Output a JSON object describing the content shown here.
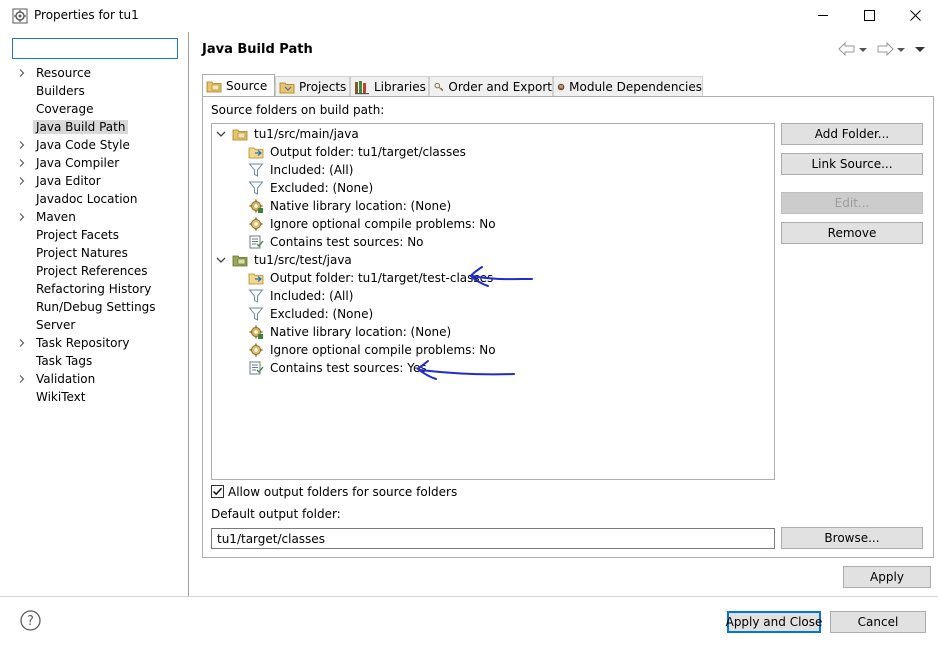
{
  "window": {
    "title": "Properties for tu1",
    "icons": {
      "app": "properties-icon",
      "minimize": "minimize-icon",
      "maximize": "maximize-icon",
      "close": "close-icon"
    }
  },
  "filter": {
    "value": "",
    "placeholder": ""
  },
  "nav": {
    "items": [
      {
        "label": "Resource",
        "expandable": true
      },
      {
        "label": "Builders",
        "expandable": false
      },
      {
        "label": "Coverage",
        "expandable": false
      },
      {
        "label": "Java Build Path",
        "expandable": false,
        "selected": true
      },
      {
        "label": "Java Code Style",
        "expandable": true
      },
      {
        "label": "Java Compiler",
        "expandable": true
      },
      {
        "label": "Java Editor",
        "expandable": true
      },
      {
        "label": "Javadoc Location",
        "expandable": false
      },
      {
        "label": "Maven",
        "expandable": true
      },
      {
        "label": "Project Facets",
        "expandable": false
      },
      {
        "label": "Project Natures",
        "expandable": false
      },
      {
        "label": "Project References",
        "expandable": false
      },
      {
        "label": "Refactoring History",
        "expandable": false
      },
      {
        "label": "Run/Debug Settings",
        "expandable": false
      },
      {
        "label": "Server",
        "expandable": false
      },
      {
        "label": "Task Repository",
        "expandable": true
      },
      {
        "label": "Task Tags",
        "expandable": false
      },
      {
        "label": "Validation",
        "expandable": true
      },
      {
        "label": "WikiText",
        "expandable": false
      }
    ]
  },
  "page": {
    "title": "Java Build Path"
  },
  "tabs": [
    {
      "label": "Source",
      "icon": "source-folder-icon",
      "active": true
    },
    {
      "label": "Projects",
      "icon": "projects-icon",
      "active": false
    },
    {
      "label": "Libraries",
      "icon": "libraries-icon",
      "active": false
    },
    {
      "label": "Order and Export",
      "icon": "order-export-icon",
      "active": false
    },
    {
      "label": "Module Dependencies",
      "icon": "module-icon",
      "active": false
    }
  ],
  "source": {
    "section_label": "Source folders on build path:",
    "folders": [
      {
        "path": "tu1/src/main/java",
        "expanded": true,
        "attributes": [
          {
            "label": "Output folder: tu1/target/classes",
            "icon": "output-folder-icon"
          },
          {
            "label": "Included: (All)",
            "icon": "filter-icon"
          },
          {
            "label": "Excluded: (None)",
            "icon": "filter-icon"
          },
          {
            "label": "Native library location: (None)",
            "icon": "native-library-icon"
          },
          {
            "label": "Ignore optional compile problems: No",
            "icon": "ignore-problems-icon"
          },
          {
            "label": "Contains test sources: No",
            "icon": "test-sources-icon"
          }
        ]
      },
      {
        "path": "tu1/src/test/java",
        "expanded": true,
        "attributes": [
          {
            "label": "Output folder: tu1/target/test-classes",
            "icon": "output-folder-icon"
          },
          {
            "label": "Included: (All)",
            "icon": "filter-icon"
          },
          {
            "label": "Excluded: (None)",
            "icon": "filter-icon"
          },
          {
            "label": "Native library location: (None)",
            "icon": "native-library-icon"
          },
          {
            "label": "Ignore optional compile problems: No",
            "icon": "ignore-problems-icon"
          },
          {
            "label": "Contains test sources: Yes",
            "icon": "test-sources-icon"
          }
        ]
      }
    ],
    "buttons": {
      "add_folder": "Add Folder...",
      "link_source": "Link Source...",
      "edit": "Edit...",
      "remove": "Remove"
    },
    "allow_output_folders": {
      "label": "Allow output folders for source folders",
      "checked": true
    },
    "default_output": {
      "label": "Default output folder:",
      "value": "tu1/target/classes",
      "browse": "Browse..."
    }
  },
  "apply_label": "Apply",
  "footer": {
    "apply_close": "Apply and Close",
    "cancel": "Cancel",
    "help_icon": "help-icon"
  },
  "colors": {
    "accent": "#0078d7",
    "annotation_ink": "#1f2bd1",
    "selected_nav": "#d9d9d9"
  }
}
